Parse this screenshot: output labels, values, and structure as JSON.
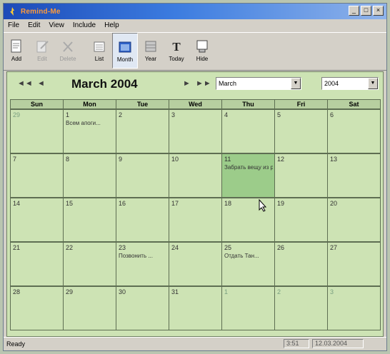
{
  "window": {
    "title": "Remind-Me"
  },
  "menu": [
    "File",
    "Edit",
    "View",
    "Include",
    "Help"
  ],
  "toolbar": [
    {
      "label": "Add",
      "icon": "add-icon",
      "state": "normal"
    },
    {
      "label": "Edit",
      "icon": "edit-icon",
      "state": "disabled"
    },
    {
      "label": "Delete",
      "icon": "delete-icon",
      "state": "disabled"
    },
    {
      "label": "List",
      "icon": "list-icon",
      "state": "normal"
    },
    {
      "label": "Month",
      "icon": "month-icon",
      "state": "pressed"
    },
    {
      "label": "Year",
      "icon": "year-icon",
      "state": "normal"
    },
    {
      "label": "Today",
      "icon": "today-icon",
      "state": "normal"
    },
    {
      "label": "Hide",
      "icon": "hide-icon",
      "state": "normal"
    }
  ],
  "nav": {
    "prev_year": "◄◄",
    "prev_month": "◄",
    "month_title": "March 2004",
    "next_month": "►",
    "next_year": "►►",
    "month_select": "March",
    "year_select": "2004"
  },
  "days_header": [
    "Sun",
    "Mon",
    "Tue",
    "Wed",
    "Thu",
    "Fri",
    "Sat"
  ],
  "weeks": [
    [
      {
        "n": "29",
        "other": true
      },
      {
        "n": "1",
        "note": "Всем апоги..."
      },
      {
        "n": "2"
      },
      {
        "n": "3"
      },
      {
        "n": "4"
      },
      {
        "n": "5"
      },
      {
        "n": "6"
      }
    ],
    [
      {
        "n": "7"
      },
      {
        "n": "8"
      },
      {
        "n": "9"
      },
      {
        "n": "10"
      },
      {
        "n": "11",
        "note": "Забрать вещу из ремонта",
        "selected": true
      },
      {
        "n": "12"
      },
      {
        "n": "13"
      }
    ],
    [
      {
        "n": "14"
      },
      {
        "n": "15"
      },
      {
        "n": "16"
      },
      {
        "n": "17"
      },
      {
        "n": "18"
      },
      {
        "n": "19"
      },
      {
        "n": "20"
      }
    ],
    [
      {
        "n": "21"
      },
      {
        "n": "22"
      },
      {
        "n": "23",
        "note": "Позвонить ..."
      },
      {
        "n": "24"
      },
      {
        "n": "25",
        "note": "Отдать Тан..."
      },
      {
        "n": "26"
      },
      {
        "n": "27"
      }
    ],
    [
      {
        "n": "28"
      },
      {
        "n": "29"
      },
      {
        "n": "30"
      },
      {
        "n": "31"
      },
      {
        "n": "1",
        "other": true
      },
      {
        "n": "2",
        "other": true
      },
      {
        "n": "3",
        "other": true
      }
    ]
  ],
  "status": {
    "text": "Ready",
    "time": "3:51",
    "date": "12.03.2004"
  },
  "colors": {
    "calendar_bg": "#cde3b4",
    "selected_day": "#9ccc8a",
    "title_bar": "#1c4bb8"
  }
}
